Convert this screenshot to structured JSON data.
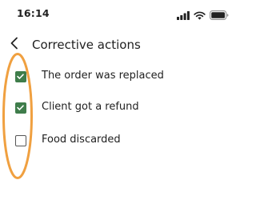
{
  "status_bar": {
    "time": "16:14",
    "icons": [
      "signal-icon",
      "wifi-icon",
      "battery-icon"
    ]
  },
  "nav": {
    "back_icon": "chevron-left-icon",
    "title": "Corrective actions"
  },
  "actions": [
    {
      "label": "The order was replaced",
      "checked": true
    },
    {
      "label": "Client got a refund",
      "checked": true
    },
    {
      "label": "Food discarded",
      "checked": false
    }
  ],
  "colors": {
    "checkbox_checked": "#3f7d4b",
    "checkbox_unchecked_border": "#555555",
    "highlight_ring": "#f0a040",
    "text": "#1f1f1f"
  }
}
